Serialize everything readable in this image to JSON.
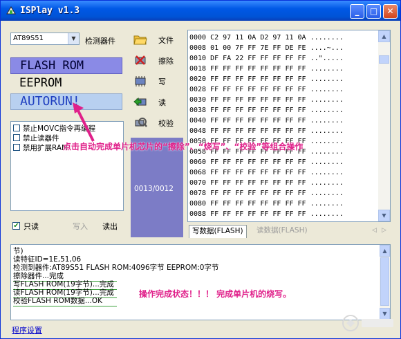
{
  "window": {
    "title": "ISPlay v1.3"
  },
  "chip": {
    "selected": "AT89S51",
    "detect_label": "检测器件"
  },
  "modes": {
    "flash": "FLASH ROM",
    "eeprom": "EEPROM",
    "autorun": "AUTORUN!"
  },
  "options": [
    {
      "label": "禁止MOVC指令再编程",
      "checked": false
    },
    {
      "label": "禁止读器件",
      "checked": false
    },
    {
      "label": "禁用扩展RAM",
      "checked": false
    }
  ],
  "bottom_controls": {
    "readonly_label": "只读",
    "readonly_checked": true,
    "write_label": "写入",
    "read_label": "读出"
  },
  "actions": [
    {
      "label": "文件",
      "icon": "folder-icon"
    },
    {
      "label": "擦除",
      "icon": "erase-icon"
    },
    {
      "label": "写",
      "icon": "write-chip-icon"
    },
    {
      "label": "读",
      "icon": "read-chip-icon"
    },
    {
      "label": "校验",
      "icon": "verify-icon"
    }
  ],
  "counter": "0013/0012",
  "hex_rows": [
    "0000 C2 97 11 0A D2 97 11 0A ........",
    "0008 01 00 7F FF 7E FF DE FE ....~...",
    "0010 DF FA 22 FF FF FF FF FF ..\".....",
    "0018 FF FF FF FF FF FF FF FF ........",
    "0020 FF FF FF FF FF FF FF FF ........",
    "0028 FF FF FF FF FF FF FF FF ........",
    "0030 FF FF FF FF FF FF FF FF ........",
    "0038 FF FF FF FF FF FF FF FF ........",
    "0040 FF FF FF FF FF FF FF FF ........",
    "0048 FF FF FF FF FF FF FF FF ........",
    "0050 FF FF FF FF FF FF FF FF ........",
    "0058 FF FF FF FF FF FF FF FF ........",
    "0060 FF FF FF FF FF FF FF FF ........",
    "0068 FF FF FF FF FF FF FF FF ........",
    "0070 FF FF FF FF FF FF FF FF ........",
    "0078 FF FF FF FF FF FF FF FF ........",
    "0080 FF FF FF FF FF FF FF FF ........",
    "0088 FF FF FF FF FF FF FF FF ........"
  ],
  "tabs": {
    "write_data": "写数据(FLASH)",
    "read_data": "读数据(FLASH)"
  },
  "log_lines": [
    "节)",
    "读特征ID=1E,51,06",
    "检测到器件:AT89S51    FLASH ROM:4096字节    EEPROM:0字节",
    "擦除器件...完成",
    "写FLASH ROM(19字节)...完成",
    "读FLASH ROM(19字节)...完成",
    "校验FLASH ROM数据...OK"
  ],
  "log_note": "操作完成状态！！！   完成单片机的烧写。",
  "annotation": "点击自动完成单片机芯片的“擦除”、“烧写”、“校验”等组合操作",
  "settings_link": "程序设置",
  "colors": {
    "titlebar": "#0058e6",
    "annotation": "#e0208a",
    "flash_mode": "#8a8ae6",
    "counter_panel": "#7c7cc6"
  }
}
